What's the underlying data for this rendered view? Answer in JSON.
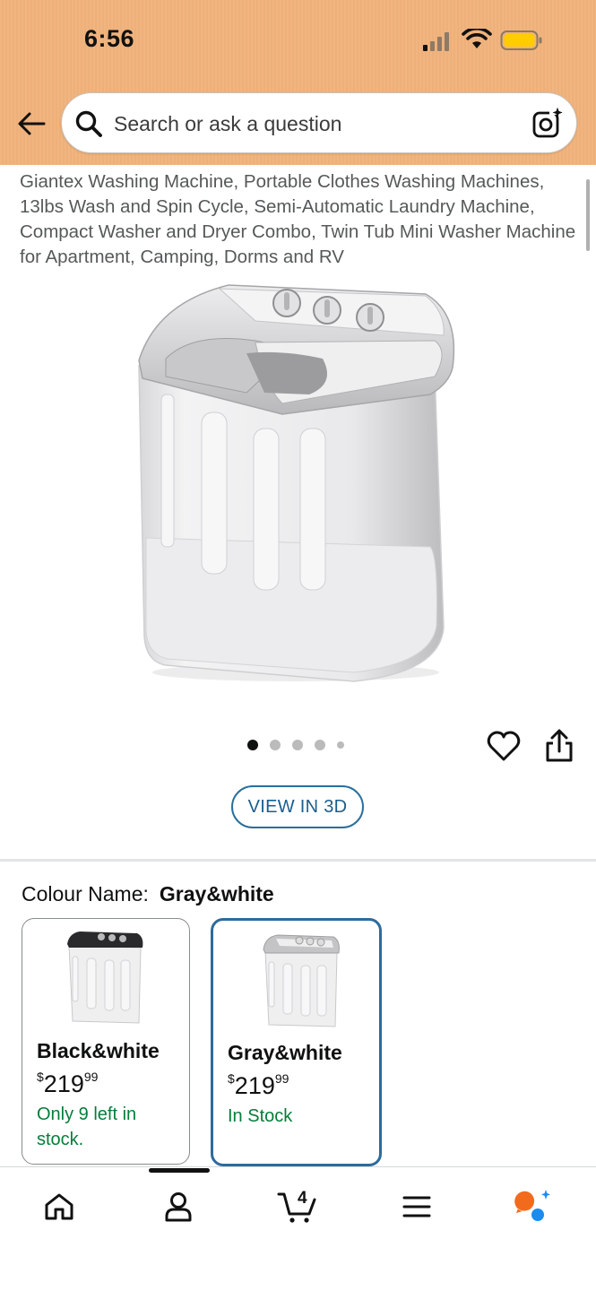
{
  "status_bar": {
    "time": "6:56"
  },
  "search": {
    "placeholder": "Search or ask a question"
  },
  "product": {
    "title": "Giantex Washing Machine, Portable Clothes Washing Machines, 13lbs Wash and Spin Cycle, Semi-Automatic Laundry Machine, Compact Washer and Dryer Combo, Twin Tub Mini Washer Machine for Apartment, Camping, Dorms and RV",
    "image_count": 5,
    "active_image": 1,
    "view_3d_label": "VIEW IN 3D"
  },
  "colour": {
    "label": "Colour Name:",
    "selected": "Gray&white",
    "options": [
      {
        "name": "Black&white",
        "currency": "$",
        "price_whole": "219",
        "price_fraction": "99",
        "stock": "Only 9 left in stock."
      },
      {
        "name": "Gray&white",
        "currency": "$",
        "price_whole": "219",
        "price_fraction": "99",
        "stock": "In Stock"
      }
    ]
  },
  "nav": {
    "cart_count": "4"
  },
  "colors": {
    "header": "#f0b27c",
    "accent": "#2d6b9c",
    "stock_green": "#067d3a",
    "rufus": "#f26b1d"
  }
}
